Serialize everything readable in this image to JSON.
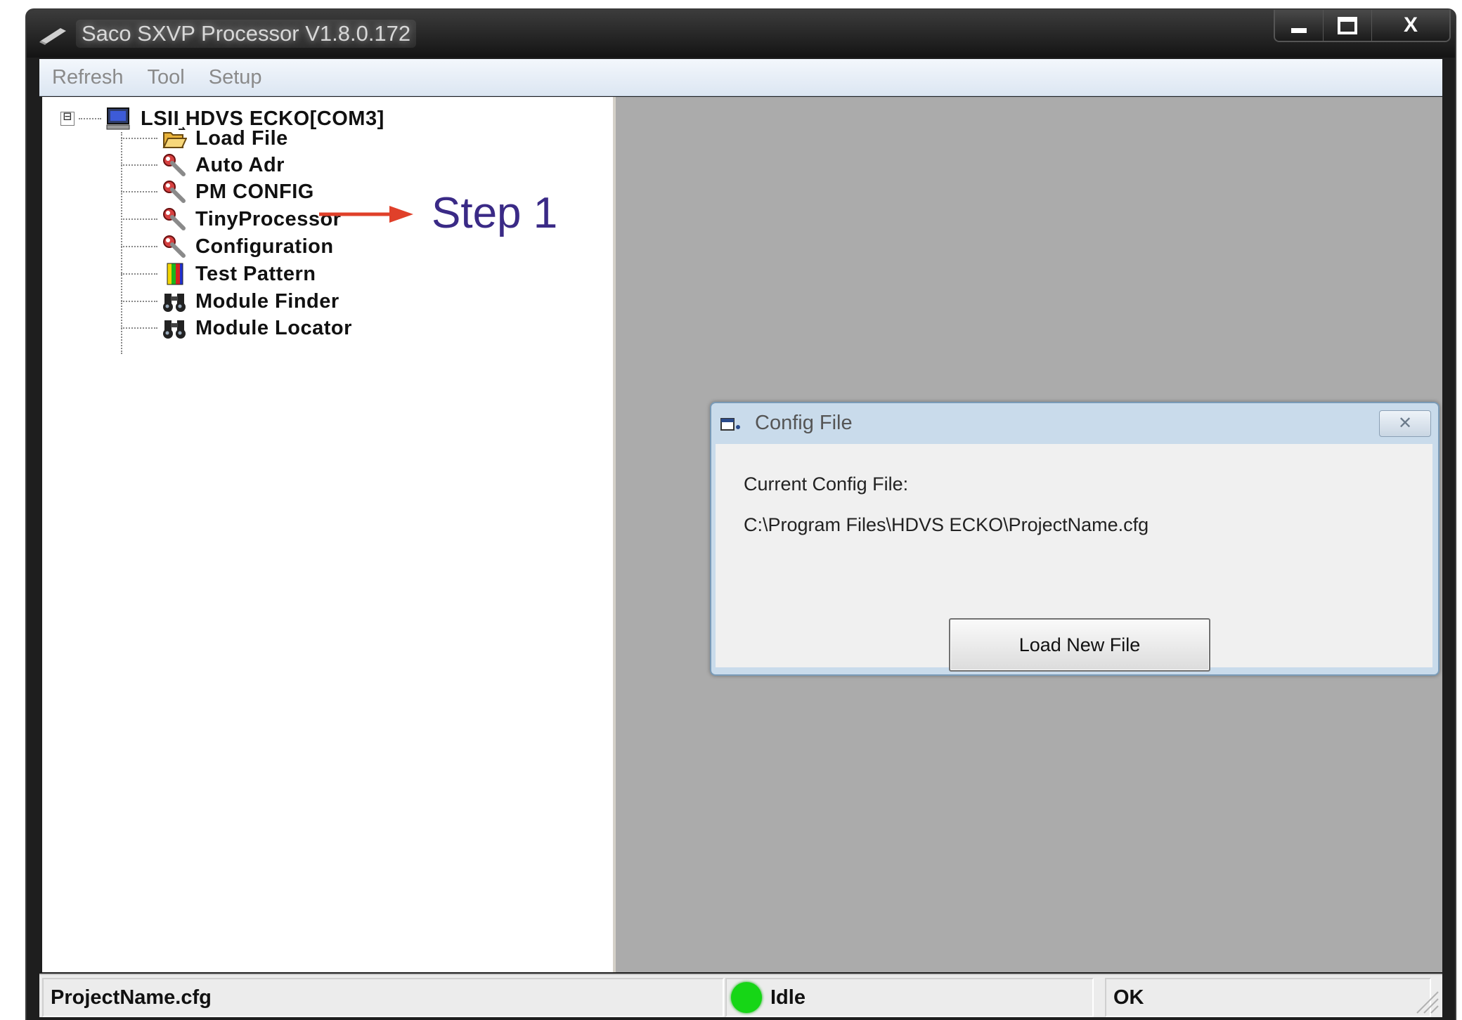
{
  "window": {
    "title": "Saco SXVP Processor  V1.8.0.172",
    "controls": {
      "minimize": "minimize",
      "maximize": "maximize",
      "close": "X"
    }
  },
  "menu": {
    "items": [
      "Refresh",
      "Tool",
      "Setup"
    ]
  },
  "tree": {
    "root": {
      "label": "LSII HDVS ECKO[COM3]",
      "icon": "monitor-icon",
      "expander": "⊟"
    },
    "items": [
      {
        "label": "Load File",
        "icon": "open-folder-icon"
      },
      {
        "label": "Auto Adr",
        "icon": "wrench-icon"
      },
      {
        "label": "PM CONFIG",
        "icon": "wrench-icon"
      },
      {
        "label": "TinyProcessor",
        "icon": "wrench-icon"
      },
      {
        "label": "Configuration",
        "icon": "wrench-icon"
      },
      {
        "label": "Test Pattern",
        "icon": "color-bars-icon"
      },
      {
        "label": "Module Finder",
        "icon": "binoculars-icon"
      },
      {
        "label": "Module Locator",
        "icon": "binoculars-icon"
      }
    ]
  },
  "annotation": {
    "text": "Step 1",
    "arrow_color": "#e0402a",
    "text_color": "#3a2a86"
  },
  "dialog": {
    "title": "Config File",
    "close": "✕",
    "current_label": "Current Config File:",
    "current_path": "C:\\Program Files\\HDVS ECKO\\ProjectName.cfg",
    "load_button": "Load New File"
  },
  "status": {
    "file": "ProjectName.cfg",
    "state": "Idle",
    "state_color": "#16d616",
    "result": "OK"
  }
}
